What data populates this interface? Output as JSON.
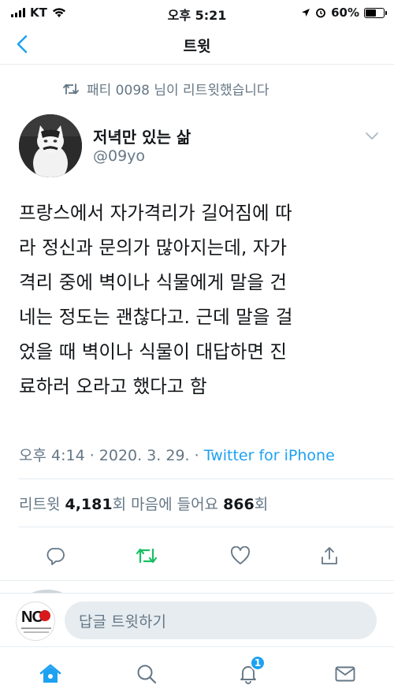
{
  "status_bar": {
    "carrier": "KT",
    "time": "오후 5:21",
    "battery_percent": "60%",
    "battery_level": 0.6
  },
  "nav": {
    "title": "트윗",
    "back_icon": "chevron-left-icon"
  },
  "retweet_banner": {
    "text": "패티 0098 님이 리트윗했습니다"
  },
  "author": {
    "name": "저녁만 있는 삶",
    "handle": "@09yo"
  },
  "tweet": {
    "lines": [
      "프랑스에서 자가격리가 길어짐에 따",
      "라 정신과 문의가 많아지는데, 자가",
      "격리 중에 벽이나 식물에게 말을 건",
      "네는 정도는 괜찮다고. 근데 말을 걸",
      "었을 때 벽이나 식물이 대답하면 진",
      "료하러 오라고 했다고 함"
    ],
    "timestamp": "오후 4:14 · 2020. 3. 29. · ",
    "source": "Twitter for iPhone"
  },
  "stats": {
    "retweet_label": "리트윗 ",
    "retweet_count": "4,181",
    "retweet_unit": "회  마음에 들어요 ",
    "like_count": "866",
    "like_unit": "회"
  },
  "composer": {
    "placeholder": "답글 트윗하기",
    "avatar_text": "NO"
  },
  "tabbar": {
    "notification_badge": "1"
  },
  "colors": {
    "accent": "#1da1f2",
    "retweet_green": "#17bf63",
    "muted": "#657786"
  }
}
